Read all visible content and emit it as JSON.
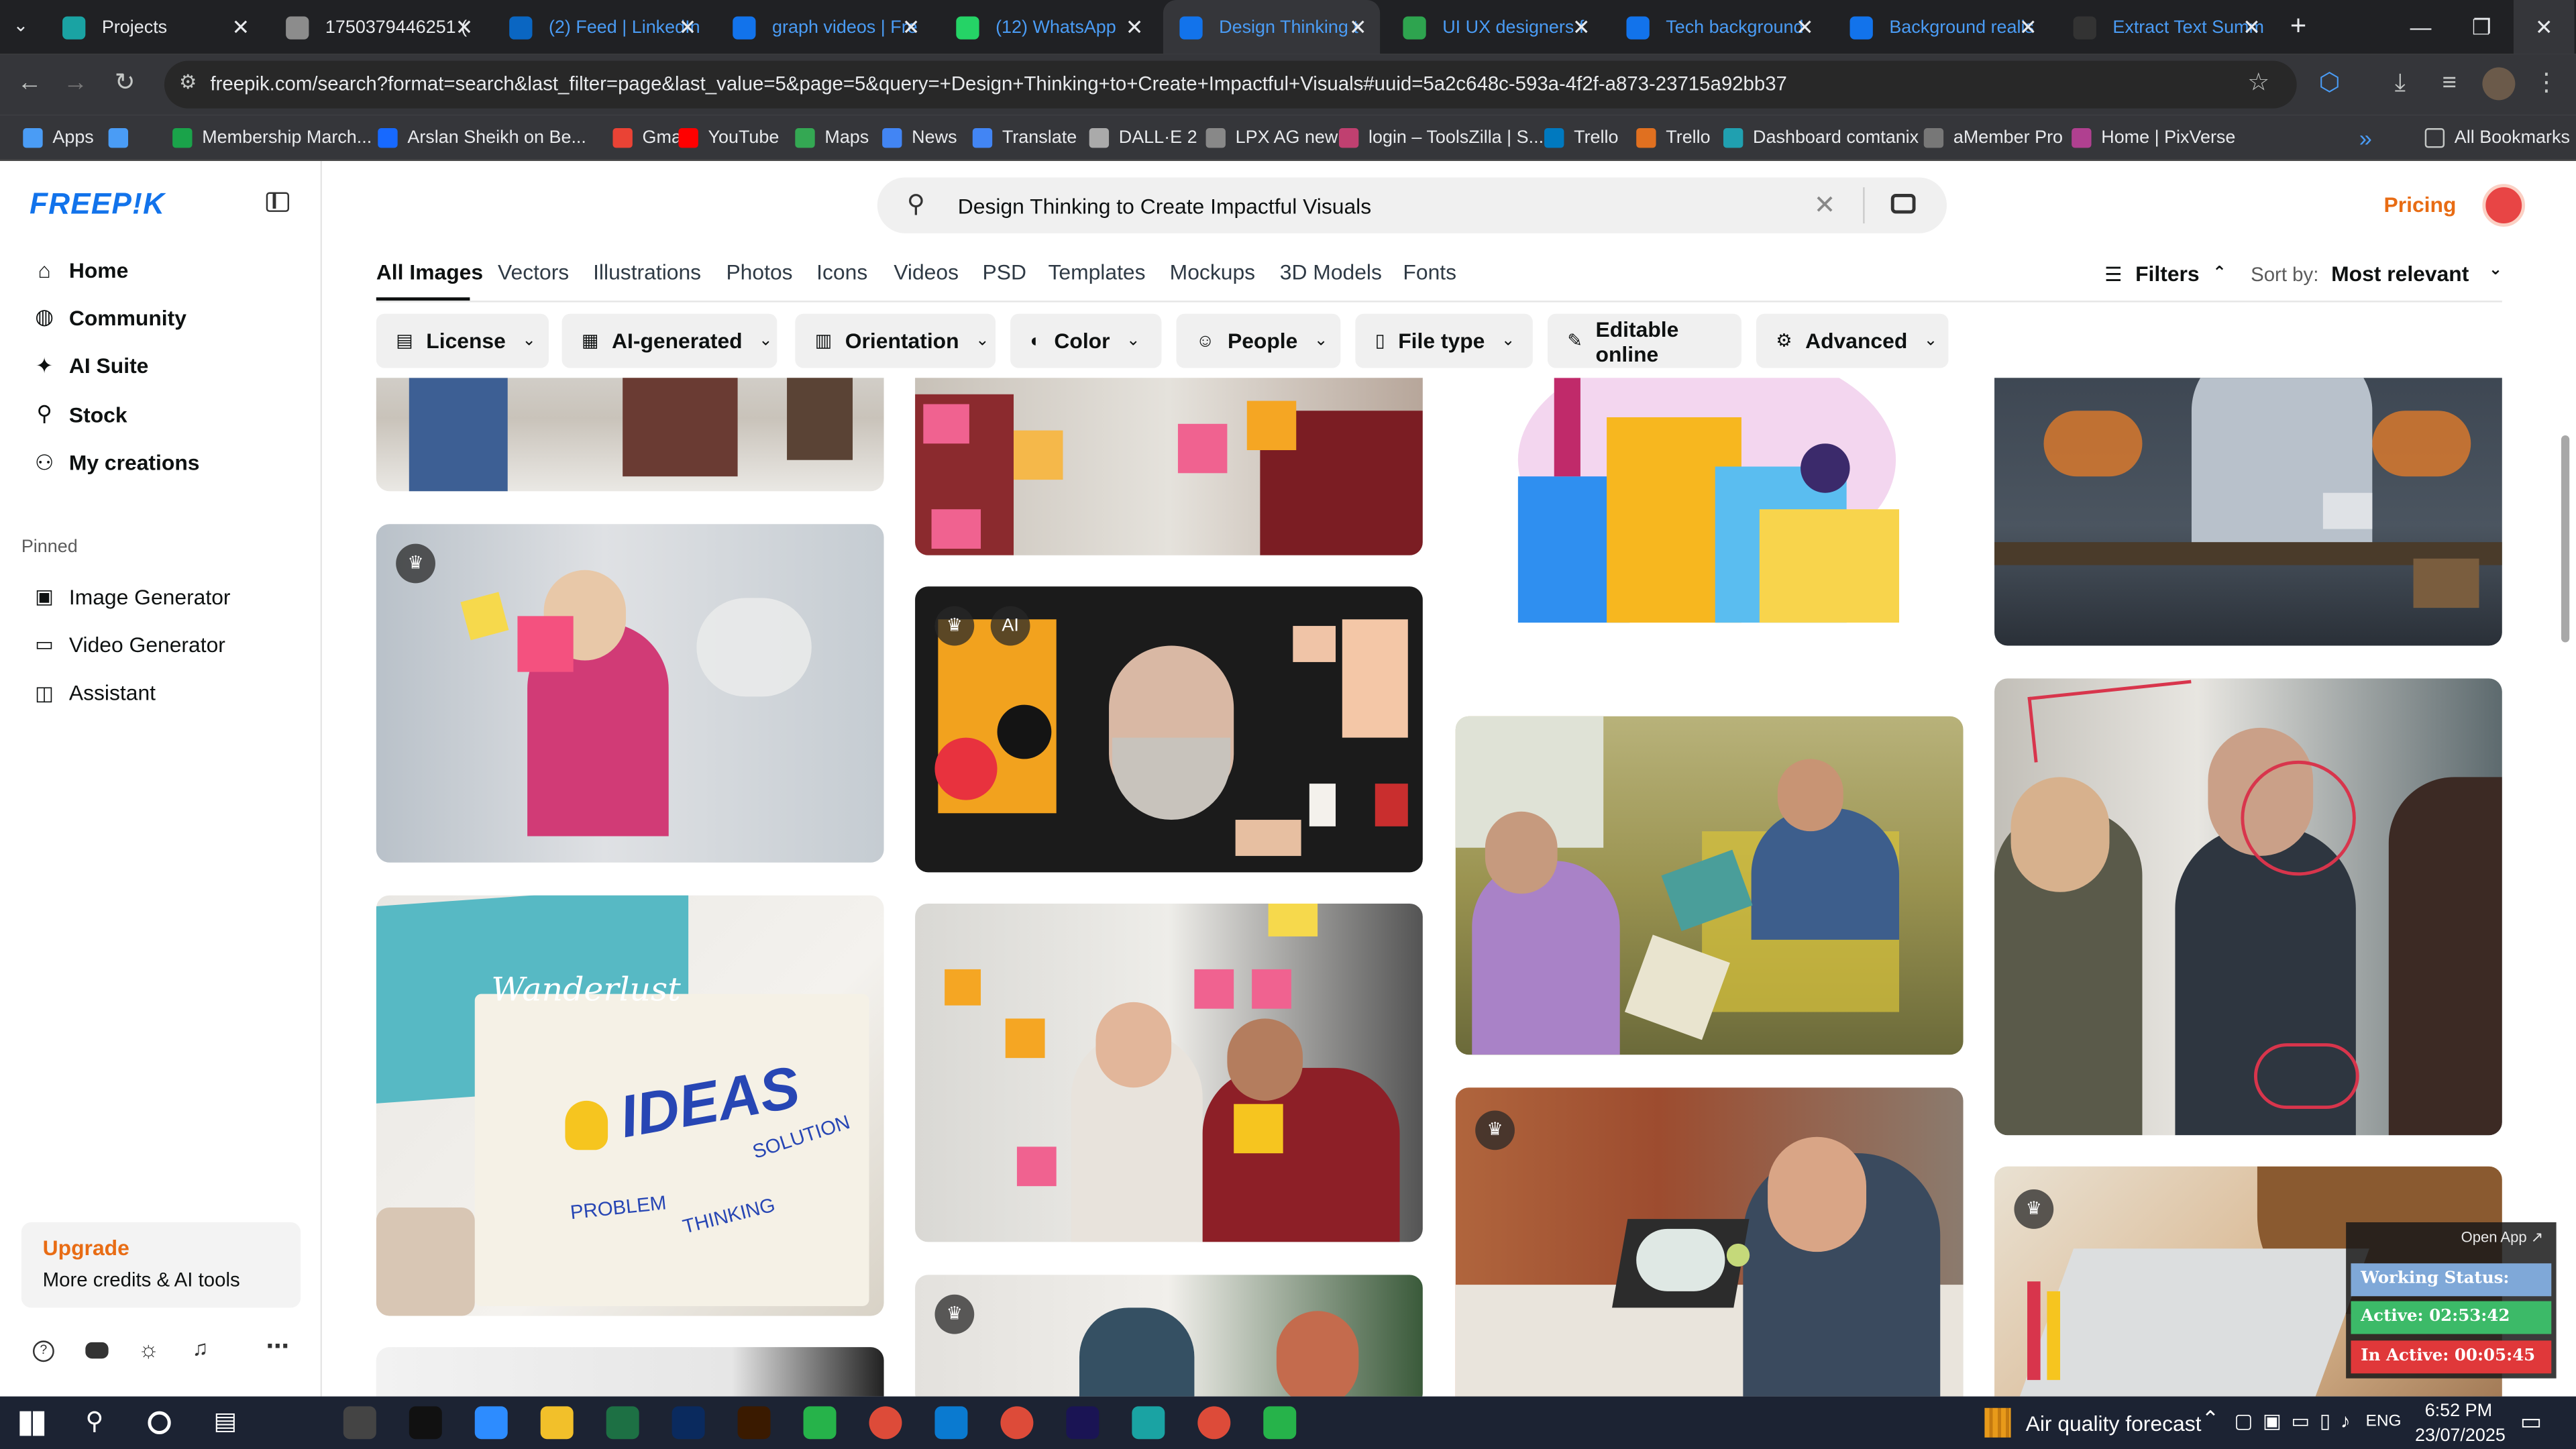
{
  "browser": {
    "tabs": [
      {
        "title": "Projects",
        "color": "#1aa3a3"
      },
      {
        "title": "1750379446251 (",
        "color": "#8c8c8c"
      },
      {
        "title": "(2) Feed | LinkedIn",
        "color": "#0a66c2"
      },
      {
        "title": "graph videos | Fre",
        "color": "#1273eb"
      },
      {
        "title": "(12) WhatsApp",
        "color": "#25d366"
      },
      {
        "title": "Design Thinking t",
        "color": "#1273eb"
      },
      {
        "title": "UI UX designers f",
        "color": "#2ea44f"
      },
      {
        "title": "Tech background",
        "color": "#1273eb"
      },
      {
        "title": "Background realis",
        "color": "#1273eb"
      },
      {
        "title": "Extract Text Summ",
        "color": "#333333"
      }
    ],
    "new_tab": "+",
    "url": "freepik.com/search?format=search&last_filter=page&last_value=5&page=5&query=+Design+Thinking+to+Create+Impactful+Visuals#uuid=5a2c648c-593a-4f2f-a873-23715a92bb37",
    "bookmarks": [
      {
        "label": "Apps",
        "color": "#4a9cf5"
      },
      {
        "label": "",
        "color": "#4a9cf5"
      },
      {
        "label": "Membership March...",
        "color": "#1aa34a"
      },
      {
        "label": "Arslan Sheikh on Be...",
        "color": "#1769ff"
      },
      {
        "label": "Gmail",
        "color": "#ea4335"
      },
      {
        "label": "YouTube",
        "color": "#ff0000"
      },
      {
        "label": "Maps",
        "color": "#34a853"
      },
      {
        "label": "News",
        "color": "#4285f4"
      },
      {
        "label": "Translate",
        "color": "#4285f4"
      },
      {
        "label": "DALL·E 2",
        "color": "#aaaaaa"
      },
      {
        "label": "LPX AG new",
        "color": "#888888"
      },
      {
        "label": "login – ToolsZilla | S...",
        "color": "#c04070"
      },
      {
        "label": "Trello",
        "color": "#0079bf"
      },
      {
        "label": "Trello",
        "color": "#e07020"
      },
      {
        "label": "Dashboard comtanix",
        "color": "#20a0b0"
      },
      {
        "label": "aMember Pro",
        "color": "#777777"
      },
      {
        "label": "Home | PixVerse",
        "color": "#b04090"
      }
    ],
    "more_bookmarks": "»",
    "all_bookmarks": "All Bookmarks"
  },
  "freepik": {
    "logo": "FREEP!K",
    "nav": [
      {
        "label": "Home",
        "icon": "home-icon",
        "glyph": "⌂"
      },
      {
        "label": "Community",
        "icon": "globe-icon",
        "glyph": "◍"
      },
      {
        "label": "AI Suite",
        "icon": "sparkle-icon",
        "glyph": "✦"
      },
      {
        "label": "Stock",
        "icon": "search-icon",
        "glyph": "⚲"
      },
      {
        "label": "My creations",
        "icon": "person-icon",
        "glyph": "⚇"
      }
    ],
    "pinned_title": "Pinned",
    "pinned": [
      {
        "label": "Image Generator",
        "icon": "image-icon",
        "glyph": "▣"
      },
      {
        "label": "Video Generator",
        "icon": "video-icon",
        "glyph": "▭"
      },
      {
        "label": "Assistant",
        "icon": "chat-icon",
        "glyph": "◫"
      }
    ],
    "upgrade": {
      "title": "Upgrade",
      "subtitle": "More credits & AI tools"
    },
    "search_query": "Design Thinking to Create Impactful Visuals",
    "pricing": "Pricing",
    "content_tabs": [
      "All Images",
      "Vectors",
      "Illustrations",
      "Photos",
      "Icons",
      "Videos",
      "PSD",
      "Templates",
      "Mockups",
      "3D Models",
      "Fonts"
    ],
    "filters_label": "Filters",
    "sort_label": "Sort by:",
    "sort_value": "Most relevant",
    "filter_buttons": [
      {
        "label": "License",
        "glyph": "▤"
      },
      {
        "label": "AI-generated",
        "glyph": "▦"
      },
      {
        "label": "Orientation",
        "glyph": "▥"
      },
      {
        "label": "Color",
        "glyph": "◐"
      },
      {
        "label": "People",
        "glyph": "☺"
      },
      {
        "label": "File type",
        "glyph": "▯"
      },
      {
        "label": "Editable online",
        "glyph": "✎"
      },
      {
        "label": "Advanced",
        "glyph": "⚙"
      }
    ],
    "image_texts": {
      "ideas": "IDEAS",
      "problem": "PROBLEM",
      "thinking": "THINKING",
      "solution": "SOLUTION",
      "wanderlust": "Wanderlust"
    }
  },
  "work_widget": {
    "open_app": "Open App ↗",
    "status": "Working Status: Active",
    "active": "Active: 02:53:42",
    "inactive": "In Active: 00:05:45"
  },
  "taskbar": {
    "weather": "Air quality forecast",
    "lang": "ENG",
    "time": "6:52 PM",
    "date": "23/07/2025"
  }
}
